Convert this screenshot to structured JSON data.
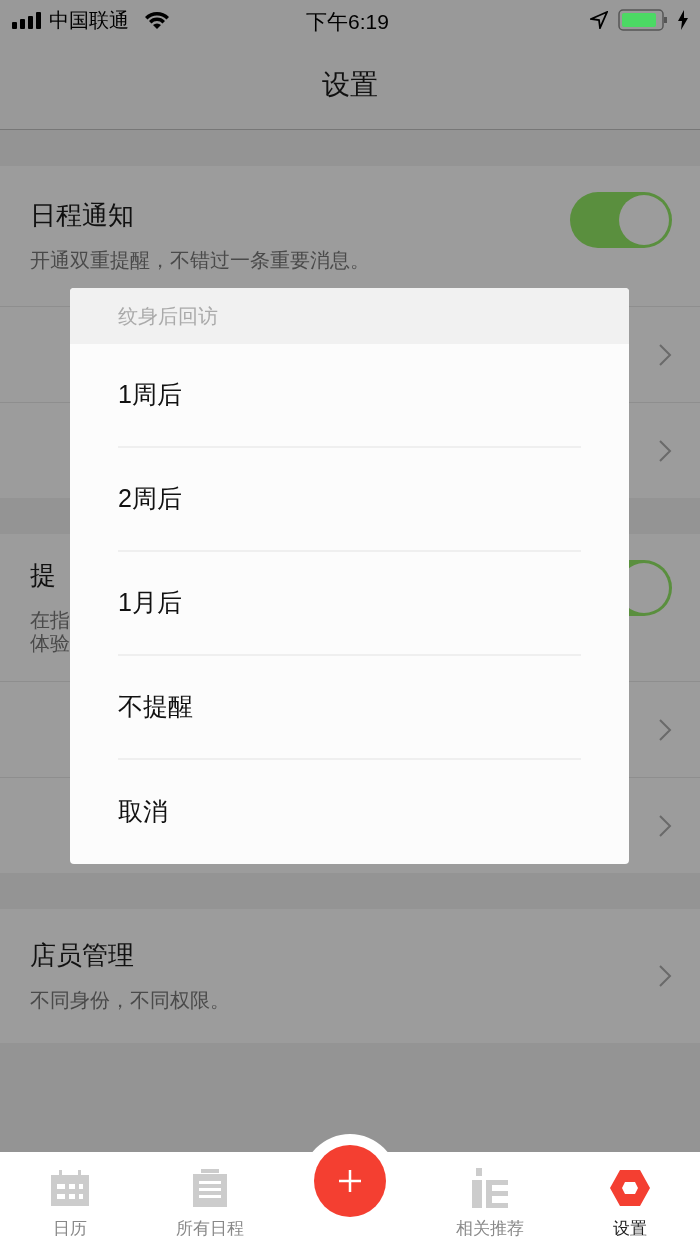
{
  "status_bar": {
    "carrier": "中国联通",
    "time": "下午6:19"
  },
  "nav": {
    "title": "设置"
  },
  "sections": [
    {
      "rows": [
        {
          "kind": "toggle",
          "title": "日程通知",
          "subtitle_lines": [
            "开通双重提醒，不错过一条重要消息。"
          ],
          "on": true
        },
        {
          "kind": "link"
        },
        {
          "kind": "link"
        }
      ]
    },
    {
      "rows": [
        {
          "kind": "toggle",
          "title": "提",
          "subtitle_lines": [
            "在指",
            "体验"
          ],
          "on": true
        },
        {
          "kind": "link"
        },
        {
          "kind": "link"
        }
      ]
    },
    {
      "rows": [
        {
          "kind": "link_sub",
          "title": "店员管理",
          "subtitle_lines": [
            "不同身份，不同权限。"
          ]
        }
      ]
    }
  ],
  "action_sheet": {
    "title": "纹身后回访",
    "options": [
      "1周后",
      "2周后",
      "1月后",
      "不提醒",
      "取消"
    ]
  },
  "tab_bar": [
    {
      "kind": "tab",
      "label": "日历",
      "selected": false
    },
    {
      "kind": "tab",
      "label": "所有日程",
      "selected": false
    },
    {
      "kind": "add"
    },
    {
      "kind": "tab",
      "label": "相关推荐",
      "selected": false
    },
    {
      "kind": "tab",
      "label": "设置",
      "selected": true
    }
  ]
}
